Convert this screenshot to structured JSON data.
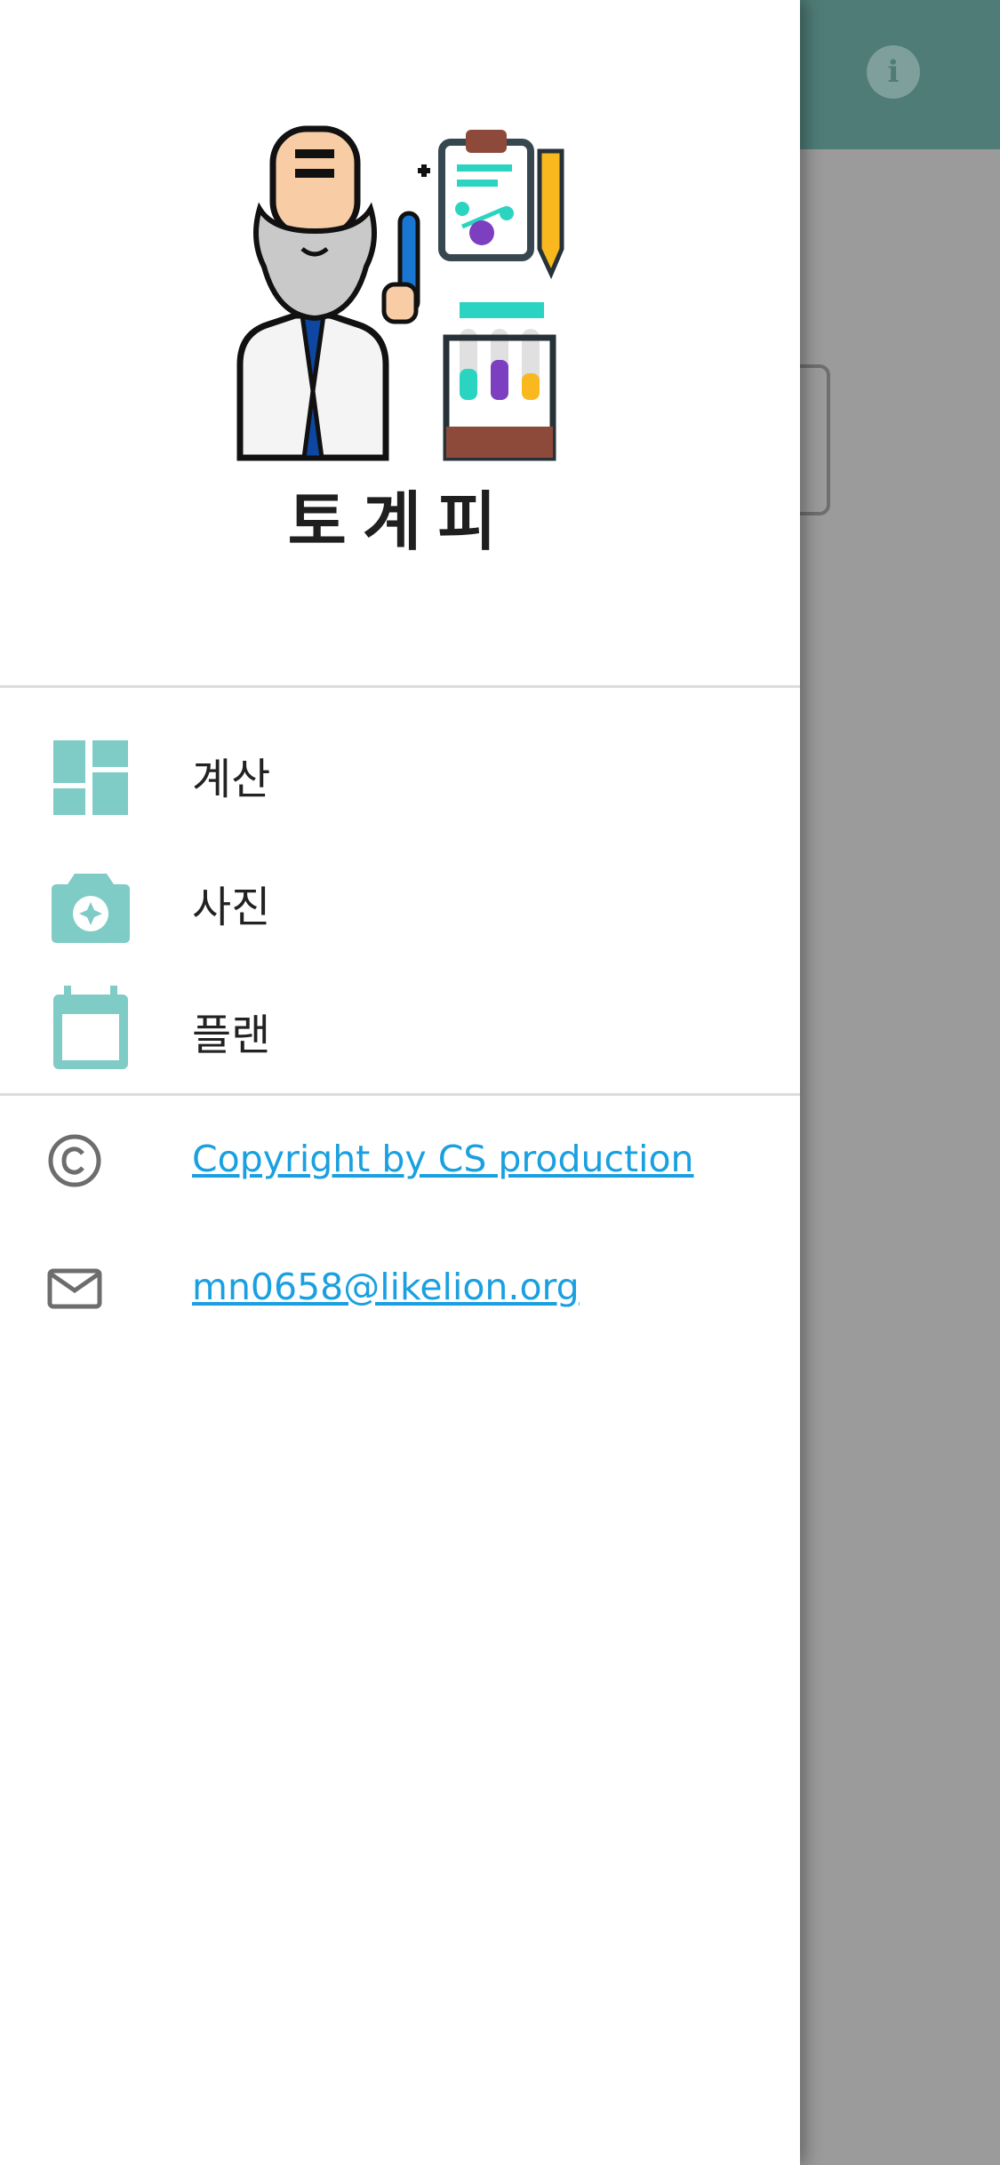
{
  "app_bar": {
    "info_icon": "info-icon",
    "info_glyph": "i"
  },
  "drawer": {
    "title": "토계피",
    "menu": [
      {
        "label": "계산",
        "icon": "dashboard-icon"
      },
      {
        "label": "사진",
        "icon": "camera-icon"
      },
      {
        "label": "플랜",
        "icon": "calendar-icon"
      }
    ],
    "links": [
      {
        "text": "Copyright by CS production",
        "icon": "copyright-icon"
      },
      {
        "text": "mn0658@likelion.org",
        "icon": "mail-icon"
      }
    ]
  },
  "colors": {
    "app_bar": "#4f7c77",
    "menu_icon": "#7fcbc6",
    "link": "#1aa0e0"
  }
}
